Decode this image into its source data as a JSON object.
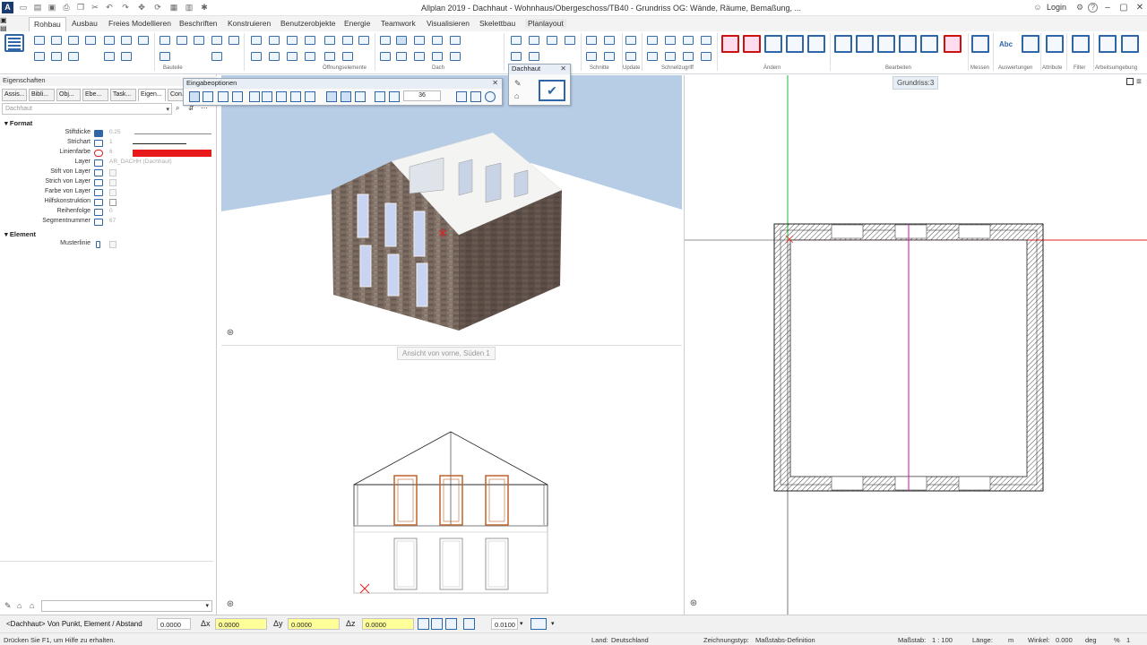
{
  "app": {
    "title": "Allplan 2019 - Dachhaut - Wohnhaus/Obergeschoss/TB40 - Grundriss OG: Wände, Räume, Bemaßung, ...",
    "login": "Login",
    "logo": "A",
    "help": "?"
  },
  "ribbon_tabs": [
    "Rohbau",
    "Ausbau",
    "Freies Modellieren",
    "Beschriften",
    "Konstruieren",
    "Benutzerobjekte",
    "Energie",
    "Teamwork",
    "Visualisieren",
    "Skelettbau",
    "Planlayout"
  ],
  "ribbon_groups": [
    "Bauteile",
    "Öffnungselemente",
    "Dach",
    "Schnitte",
    "Update",
    "Schnellzugriff",
    "Ändern",
    "Bearbeiten",
    "Messen",
    "Auswertungen",
    "Attribute",
    "Filter",
    "Arbeitsumgebung"
  ],
  "ribbon_glyph": "Abc",
  "left_panel": {
    "title": "Eigenschaften",
    "tabs": [
      "Assis...",
      "Bibli...",
      "Obj...",
      "Ebe...",
      "Task...",
      "Eigen...",
      "Con..."
    ],
    "combo_placeholder": "Dachhaut",
    "section_format": "Format",
    "section_element": "Element",
    "props": [
      {
        "label": "Stiftdicke",
        "value": "0.25"
      },
      {
        "label": "Strichart",
        "value": "1"
      },
      {
        "label": "Linienfarbe",
        "value": "6"
      },
      {
        "label": "Layer",
        "value": "AR_DACHH (Dachhaut)"
      },
      {
        "label": "Stift von Layer",
        "value": ""
      },
      {
        "label": "Strich von Layer",
        "value": ""
      },
      {
        "label": "Farbe von Layer",
        "value": ""
      },
      {
        "label": "Hilfskonstruktion",
        "value": ""
      },
      {
        "label": "Reihenfolge",
        "value": "0"
      },
      {
        "label": "Segmentnummer",
        "value": "67"
      }
    ],
    "element_props": [
      {
        "label": "Musterlinie",
        "value": ""
      }
    ]
  },
  "eingabeoptionen": {
    "title": "Eingabeoptionen",
    "value": "36"
  },
  "dachhaut_panel": {
    "title": "Dachhaut"
  },
  "viewports": {
    "elevation_label": "Ansicht von vorne, Süden 1",
    "plan_label": "Grundriss:3"
  },
  "input_bar": {
    "prompt": "<Dachhaut> Von Punkt, Element / Abstand",
    "abstand": "0.0000",
    "dx_label": "Δx",
    "dx": "0.0000",
    "dy_label": "Δy",
    "dy": "0.0000",
    "dz_label": "Δz",
    "dz": "0.0000",
    "step": "0.0100"
  },
  "status_bar": {
    "help": "Drücken Sie F1, um Hilfe zu erhalten.",
    "land": "Land:",
    "land_value": "Deutschland",
    "zeichnungstyp": "Zeichnungstyp:",
    "zeichnungstyp_value": "Maßstabs-Definition",
    "massstab": "Maßstab:",
    "massstab_value": "1 : 100",
    "laenge": "Länge:",
    "laenge_value": "m",
    "winkel": "Winkel:",
    "winkel_value": "0.000",
    "winkel_unit": "deg",
    "percent": "%",
    "percent_value": "1"
  },
  "colors": {
    "accent": "#2f66a8",
    "linienfarbe": "#e8191b",
    "sky": "#b7cde6",
    "orange": "#c0622a",
    "magenta": "#d0129f",
    "green": "#18b83a",
    "red_line": "#e02020"
  }
}
